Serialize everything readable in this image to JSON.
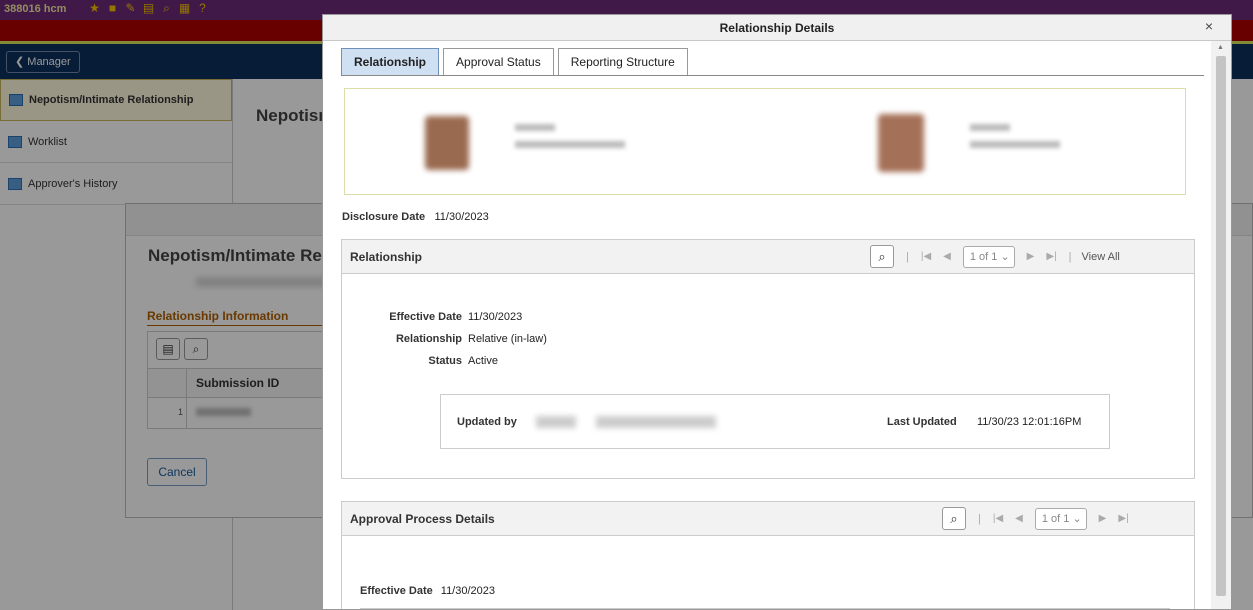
{
  "topbar": {
    "text": "388016 hcm"
  },
  "manager_button": {
    "label": "Manager"
  },
  "sidebar": {
    "items": [
      {
        "label": "Nepotism/Intimate Relationship"
      },
      {
        "label": "Worklist"
      },
      {
        "label": "Approver's History"
      }
    ]
  },
  "background": {
    "page_heading": "Nepotism",
    "dialog_title": "Nepotism/Intimate Rela",
    "section_title": "Relationship Information",
    "column_header": "Submission ID",
    "row_number": "1",
    "cancel_label": "Cancel"
  },
  "modal": {
    "title": "Relationship Details",
    "close_symbol": "×",
    "tabs": [
      {
        "label": "Relationship",
        "active": true
      },
      {
        "label": "Approval Status",
        "active": false
      },
      {
        "label": "Reporting Structure",
        "active": false
      }
    ],
    "disclosure": {
      "label": "Disclosure Date",
      "value": "11/30/2023"
    },
    "relationship_section": {
      "title": "Relationship",
      "pager": "1 of 1",
      "view_all": "View All",
      "fields": {
        "effective_date": {
          "label": "Effective Date",
          "value": "11/30/2023"
        },
        "relationship": {
          "label": "Relationship",
          "value": "Relative (in-law)"
        },
        "status": {
          "label": "Status",
          "value": "Active"
        }
      },
      "updated_by_label": "Updated by",
      "last_updated_label": "Last Updated",
      "last_updated_value": "11/30/23 12:01:16PM"
    },
    "approval_section": {
      "title": "Approval Process Details",
      "pager": "1 of 1",
      "effective_date": {
        "label": "Effective Date",
        "value": "11/30/2023"
      }
    }
  },
  "colors": {
    "topbar_red": "#b00000",
    "nav_blue": "#0a2f5c",
    "active_tab": "#cfe0f2",
    "section_orange": "#b06000"
  }
}
